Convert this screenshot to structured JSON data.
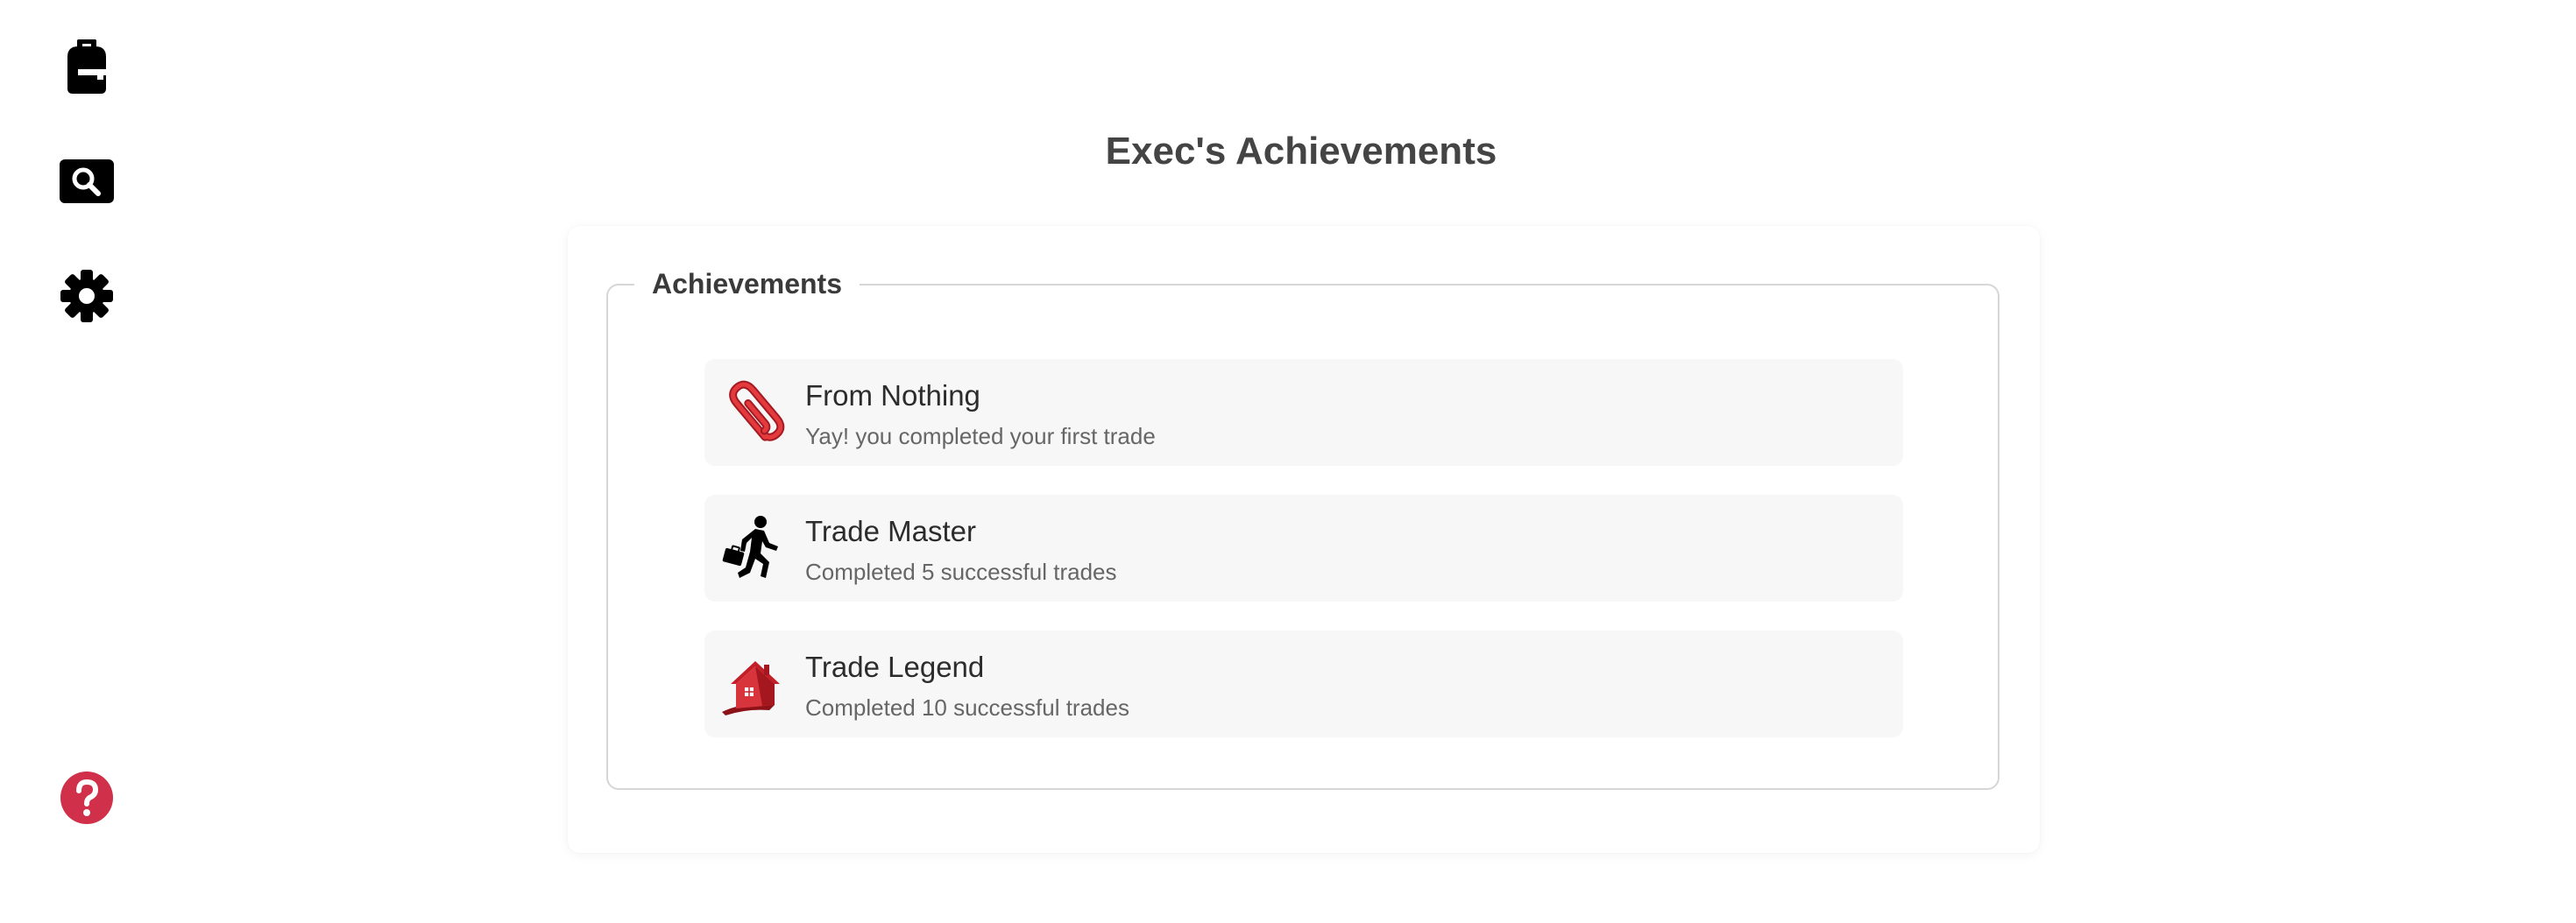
{
  "sidebar": {
    "items": [
      {
        "icon": "backpack-icon"
      },
      {
        "icon": "search-icon"
      },
      {
        "icon": "gear-icon"
      },
      {
        "icon": "help-icon",
        "color": "#d0304a"
      }
    ]
  },
  "page": {
    "title": "Exec's Achievements"
  },
  "achievements": {
    "legend": "Achievements",
    "items": [
      {
        "icon": "paperclip-icon",
        "title": "From Nothing",
        "description": "Yay! you completed your first trade"
      },
      {
        "icon": "running-businessman-icon",
        "title": "Trade Master",
        "description": "Completed 5 successful trades"
      },
      {
        "icon": "red-house-icon",
        "title": "Trade Legend",
        "description": "Completed 10 successful trades"
      }
    ]
  },
  "colors": {
    "accent_red": "#d0304a",
    "icon_dark": "#000000",
    "item_bg": "#f7f7f7",
    "border": "#d6d6d6"
  }
}
